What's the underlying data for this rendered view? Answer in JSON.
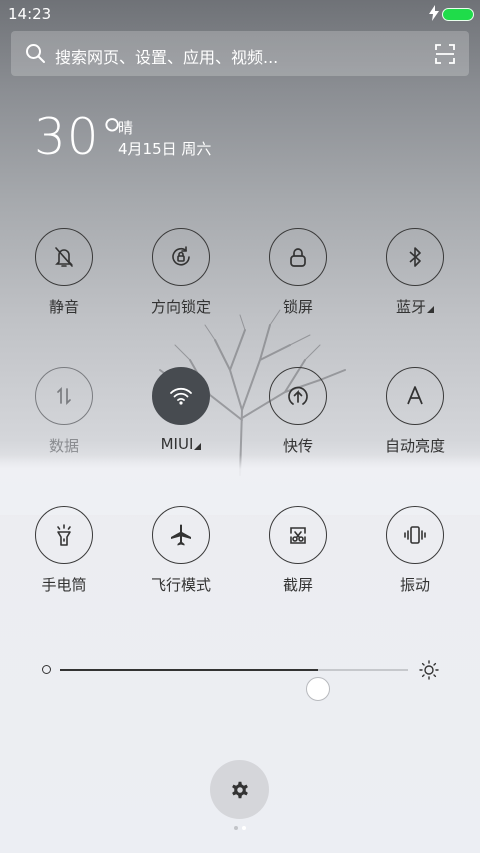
{
  "status_bar": {
    "time": "14:23"
  },
  "search": {
    "placeholder": "搜索网页、设置、应用、视频..."
  },
  "weather": {
    "temperature": "30°",
    "condition": "晴",
    "date": "4月15日 周六"
  },
  "toggles": [
    {
      "label": "静音",
      "icon": "bell-off-icon",
      "active": false
    },
    {
      "label": "方向锁定",
      "icon": "rotation-lock-icon",
      "active": false
    },
    {
      "label": "锁屏",
      "icon": "lock-icon",
      "active": false
    },
    {
      "label": "蓝牙",
      "icon": "bluetooth-icon",
      "active": false
    },
    {
      "label": "数据",
      "icon": "mobile-data-icon",
      "active": false,
      "disabled": true
    },
    {
      "label": "MIUI",
      "icon": "wifi-icon",
      "active": true
    },
    {
      "label": "快传",
      "icon": "quick-share-icon",
      "active": false
    },
    {
      "label": "自动亮度",
      "icon": "auto-brightness-icon",
      "active": false
    },
    {
      "label": "手电筒",
      "icon": "flashlight-icon",
      "active": false
    },
    {
      "label": "飞行模式",
      "icon": "airplane-icon",
      "active": false
    },
    {
      "label": "截屏",
      "icon": "screenshot-icon",
      "active": false
    },
    {
      "label": "振动",
      "icon": "vibrate-icon",
      "active": false
    }
  ],
  "brightness": {
    "level": 0.74
  },
  "pager": {
    "pages": 2,
    "current": 2
  },
  "colors": {
    "accent_active": "#474b50",
    "battery": "#1fdc4a"
  }
}
